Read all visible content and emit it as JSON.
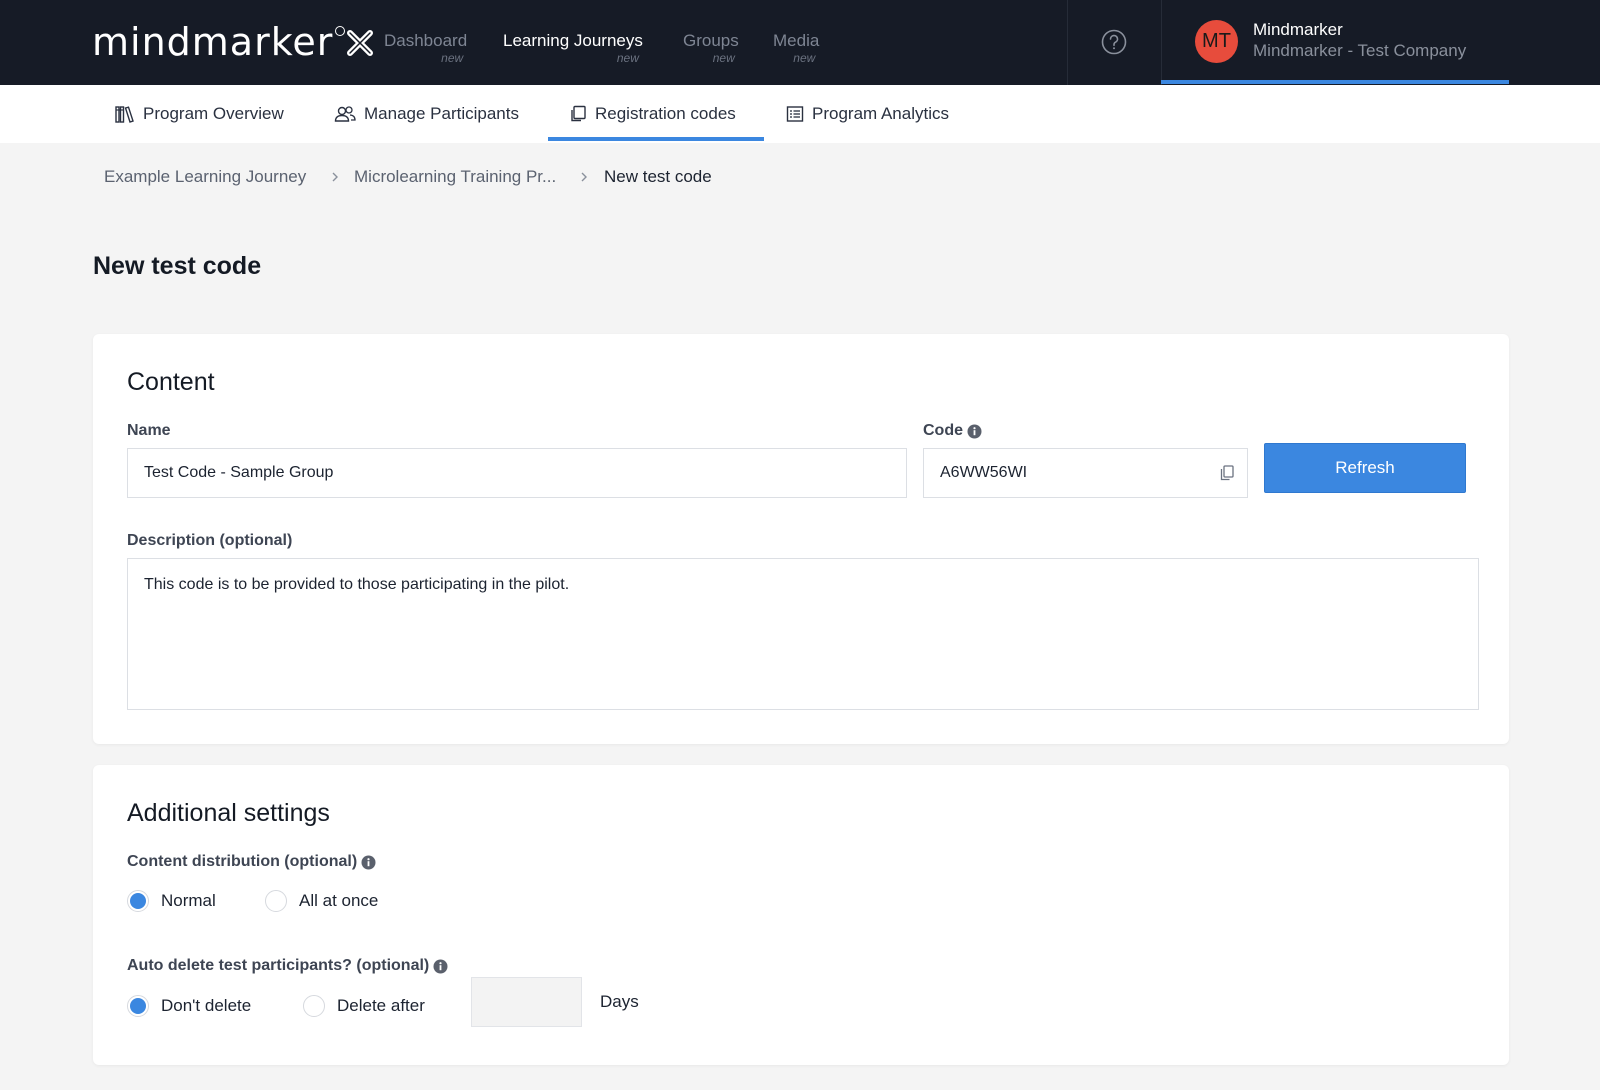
{
  "brand": {
    "name": "mindmarker"
  },
  "nav": {
    "items": [
      {
        "label": "Dashboard",
        "sub": "new",
        "active": false
      },
      {
        "label": "Learning Journeys",
        "sub": "new",
        "active": true
      },
      {
        "label": "Groups",
        "sub": "new",
        "active": false
      },
      {
        "label": "Media",
        "sub": "new",
        "active": false
      }
    ]
  },
  "user": {
    "initials": "MT",
    "name": "Mindmarker",
    "company": "Mindmarker - Test Company"
  },
  "subnav": {
    "tabs": [
      {
        "label": "Program Overview",
        "icon": "library-icon"
      },
      {
        "label": "Manage Participants",
        "icon": "users-icon"
      },
      {
        "label": "Registration codes",
        "icon": "copy-icon",
        "active": true
      },
      {
        "label": "Program Analytics",
        "icon": "list-icon"
      }
    ]
  },
  "breadcrumb": [
    "Example Learning Journey",
    "Microlearning Training Pr...",
    "New test code"
  ],
  "page": {
    "title": "New test code"
  },
  "content": {
    "title": "Content",
    "name_label": "Name",
    "name_value": "Test Code - Sample Group",
    "code_label": "Code",
    "code_value": "A6WW56WI",
    "refresh_label": "Refresh",
    "description_label": "Description (optional)",
    "description_value": "This code is to be provided to those participating in the pilot."
  },
  "settings": {
    "title": "Additional settings",
    "distribution_label": "Content distribution (optional)",
    "distribution_options": [
      "Normal",
      "All at once"
    ],
    "distribution_selected": "Normal",
    "autodelete_label": "Auto delete test participants? (optional)",
    "autodelete_options": [
      "Don't delete",
      "Delete after"
    ],
    "autodelete_selected": "Don't delete",
    "days_value": "",
    "days_label": "Days"
  },
  "colors": {
    "accent": "#3b87e0",
    "topbar": "#161b26",
    "avatar": "#e74c3c"
  }
}
